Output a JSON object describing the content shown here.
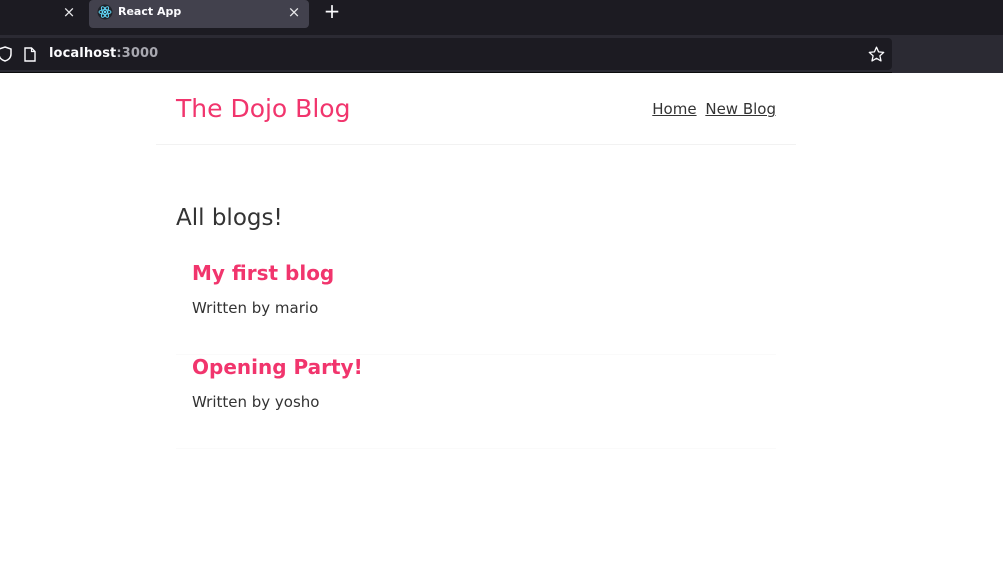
{
  "browser": {
    "tab_title": "React App",
    "tab_close_glyph": "×",
    "prev_tab_close_glyph": "×",
    "new_tab_glyph": "+",
    "url_host": "localhost",
    "url_port": ":3000",
    "icons": [
      "shield-icon",
      "page-icon",
      "bookmark-star-icon",
      "react-favicon",
      "close-icon",
      "plus-icon"
    ]
  },
  "site": {
    "title": "The Dojo Blog",
    "nav": {
      "home": "Home",
      "new_blog": "New Blog"
    },
    "accent_color": "#f1356d"
  },
  "main": {
    "heading": "All blogs!",
    "blogs": [
      {
        "title": "My first blog",
        "author_line": "Written by mario"
      },
      {
        "title": "Opening Party!",
        "author_line": "Written by yosho"
      }
    ]
  }
}
